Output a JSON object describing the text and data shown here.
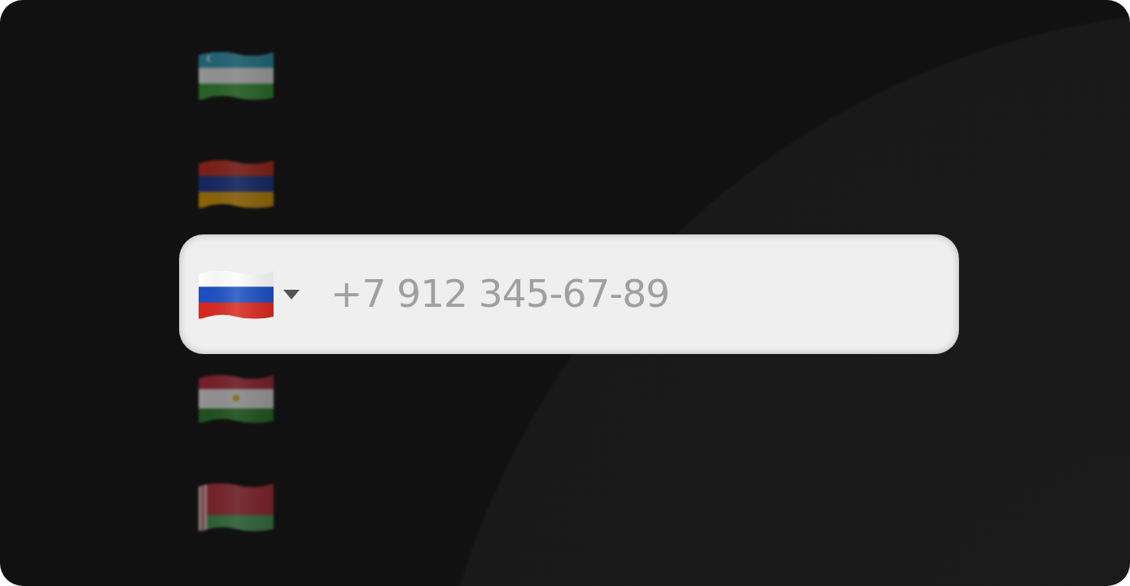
{
  "flags": [
    {
      "kind": "uzbekistan",
      "selected": false
    },
    {
      "kind": "armenia",
      "selected": false
    },
    {
      "kind": "russia",
      "selected": true
    },
    {
      "kind": "tajikistan",
      "selected": false
    },
    {
      "kind": "belarus",
      "selected": false
    }
  ],
  "phone_field": {
    "placeholder": "+7 912 345-67-89"
  }
}
